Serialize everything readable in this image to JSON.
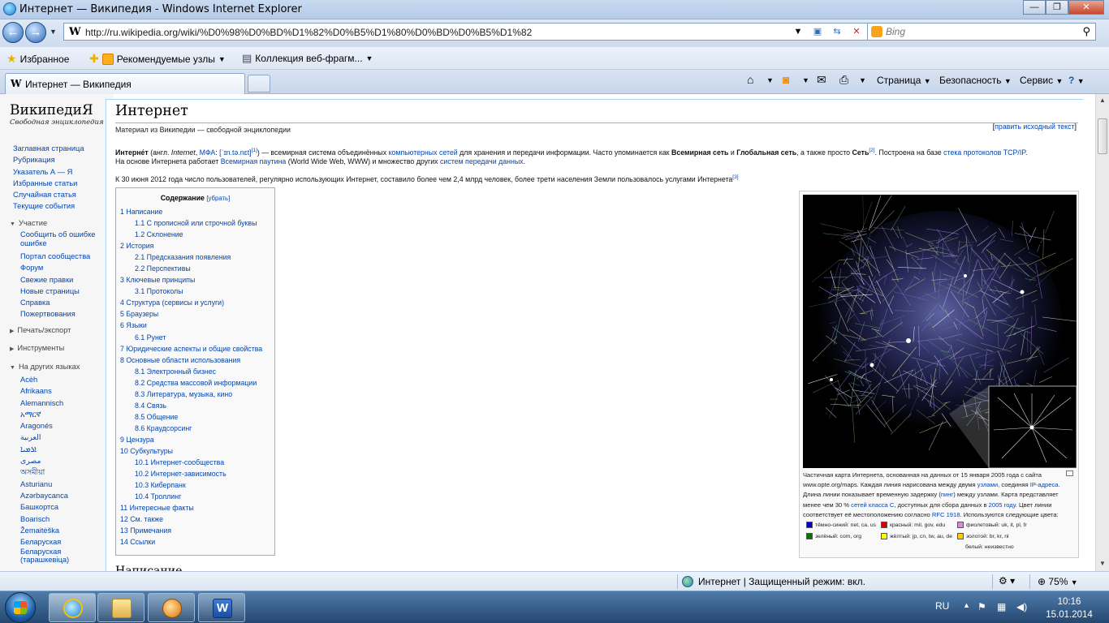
{
  "window": {
    "title": "Интернет — Википедия - Windows Internet Explorer",
    "minimize": "—",
    "maximize": "❐",
    "close": "✕"
  },
  "nav": {
    "back": "←",
    "forward": "→",
    "url": "http://ru.wikipedia.org/wiki/%D0%98%D0%BD%D1%82%D0%B5%D1%80%D0%BD%D0%B5%D1%82",
    "favicon": "W",
    "search_placeholder": "Bing"
  },
  "favbar": {
    "favorites": "Избранное",
    "suggested": "Рекомендуемые узлы",
    "gallery": "Коллекция веб-фрагм..."
  },
  "tab": {
    "label": "Интернет — Википедия",
    "favicon": "W"
  },
  "commands": {
    "page": "Страница",
    "safety": "Безопасность",
    "service": "Сервис",
    "help": "?"
  },
  "wiki": {
    "logo_title": "ВикипедиЯ",
    "logo_sub": "Свободная энциклопедия",
    "nav_links": [
      "Заглавная страница",
      "Рубрикация",
      "Указатель А — Я",
      "Избранные статьи",
      "Случайная статья",
      "Текущие события"
    ],
    "participation_head": "Участие",
    "participation_links": [
      "Сообщить об ошибке",
      "ошибке",
      "Портал сообщества",
      "Форум",
      "Свежие правки",
      "Новые страницы",
      "Справка",
      "Пожертвования"
    ],
    "print_head": "Печать/экспорт",
    "tools_head": "Инструменты",
    "lang_head": "На других языках",
    "languages": [
      "Acèh",
      "Afrikaans",
      "Alemannisch",
      "አማርኛ",
      "Aragonés",
      "العربية",
      "ܐܪܡܝܐ",
      "مصرى",
      "অসমীয়া",
      "Asturianu",
      "Azərbaycanca",
      "Башкортса",
      "Boarisch",
      "Žemaitėška",
      "Беларуская",
      "Беларуская",
      "(тарашкевіца)"
    ]
  },
  "article": {
    "title": "Интернет",
    "tagline": "Материал из Википедии — свободной энциклопедии",
    "edit_source": "править исходный текст",
    "p1_bold1": "Интерне́т",
    "p1_a": "(англ.",
    "p1_internet": "Internet",
    "p1_ipa_label": "МФА",
    "p1_ipa": "[ˈɪn.tə.nɛt]",
    "p1_sup1": "[1]",
    "p1_b": "— всемирная система объединённых",
    "p1_link1": "компьютерных сетей",
    "p1_c": "для хранения и передачи информации. Часто упоминается как",
    "p1_bold2": "Всемирная сеть",
    "p1_d": "и",
    "p1_bold3": "Глобальная сеть",
    "p1_e": ", а также просто",
    "p1_bold4": "Сеть",
    "p1_sup2": "[2]",
    "p1_f": ". Построена на базе",
    "p1_link2": "стека протоколов TCP/IP",
    "p1_g": "На основе Интернета работает",
    "p1_link3": "Всемирная паутина",
    "p1_h": "(World Wide Web, WWW) и множество других",
    "p1_link4": "систем передачи данных",
    "p2": "К 30 июня 2012 года число пользователей, регулярно использующих Интернет, составило более чем 2,4 млрд человек, более трети населения Земли пользовалось услугами Интернета",
    "p2_sup": "[3]",
    "next_heading": "Написание"
  },
  "toc": {
    "title": "Содержание",
    "hide": "[убрать]",
    "items": [
      {
        "text": "1 Написание",
        "sub": false
      },
      {
        "text": "1.1 С прописной или строчной буквы",
        "sub": true
      },
      {
        "text": "1.2 Склонение",
        "sub": true
      },
      {
        "text": "2 История",
        "sub": false
      },
      {
        "text": "2.1 Предсказания появления",
        "sub": true
      },
      {
        "text": "2.2 Перспективы",
        "sub": true
      },
      {
        "text": "3 Ключевые принципы",
        "sub": false
      },
      {
        "text": "3.1 Протоколы",
        "sub": true
      },
      {
        "text": "4 Структура (сервисы и услуги)",
        "sub": false
      },
      {
        "text": "5 Браузеры",
        "sub": false
      },
      {
        "text": "6 Языки",
        "sub": false
      },
      {
        "text": "6.1 Рунет",
        "sub": true
      },
      {
        "text": "7 Юридические аспекты и общие свойства",
        "sub": false
      },
      {
        "text": "8 Основные области использования",
        "sub": false
      },
      {
        "text": "8.1 Электронный бизнес",
        "sub": true
      },
      {
        "text": "8.2 Средства массовой информации",
        "sub": true
      },
      {
        "text": "8.3 Литература, музыка, кино",
        "sub": true
      },
      {
        "text": "8.4 Связь",
        "sub": true
      },
      {
        "text": "8.5 Общение",
        "sub": true
      },
      {
        "text": "8.6 Краудсорсинг",
        "sub": true
      },
      {
        "text": "9 Цензура",
        "sub": false
      },
      {
        "text": "10 Субкультуры",
        "sub": false
      },
      {
        "text": "10.1 Интернет-сообщества",
        "sub": true
      },
      {
        "text": "10.2 Интернет-зависимость",
        "sub": true
      },
      {
        "text": "10.3 Киберпанк",
        "sub": true
      },
      {
        "text": "10.4 Троллинг",
        "sub": true
      },
      {
        "text": "11 Интересные факты",
        "sub": false
      },
      {
        "text": "12 См. также",
        "sub": false
      },
      {
        "text": "13 Примечания",
        "sub": false
      },
      {
        "text": "14 Ссылки",
        "sub": false
      }
    ]
  },
  "figure": {
    "cap_l1": "Частичная карта Интернета, основанная на данных от 15 января 2005 года с сайта",
    "cap_l2a": "www.opte.org/maps. Каждая линия нарисована между двумя",
    "cap_l2_link1": "узлами",
    "cap_l2b": ", соединяя",
    "cap_l2_link2": "IP-адреса",
    "cap_l3a": "Длина линии показывает временную задержку (",
    "cap_l3_link": "пинг",
    "cap_l3b": ") между узлами. Карта представляет",
    "cap_l4a": "менее чем 30 %",
    "cap_l4_link1": "сетей класса C",
    "cap_l4b": ", доступных для сбора данных в",
    "cap_l4_link2": "2005 году",
    "cap_l4c": ". Цвет линии",
    "cap_l5a": "соответствует её местоположению согласно",
    "cap_l5_link": "RFC 1918",
    "cap_l5b": ". Используются следующие цвета:",
    "legend": [
      {
        "label": "тёмно-синий: net, ca, us",
        "color": "#0000cc"
      },
      {
        "label": "красный: mil, gov, edu",
        "color": "#dd0000"
      },
      {
        "label": "фиолетовый: uk, it, pl, fr",
        "color": "#dd88dd"
      },
      {
        "label": "зелёный: com, org",
        "color": "#007700"
      },
      {
        "label": "жёлтый: jp, cn, tw, au, de",
        "color": "#ffff00"
      },
      {
        "label": "золотой: br, kr, nl",
        "color": "#ffcc00"
      },
      {
        "label": "белый: неизвестно",
        "color": "#ffffff"
      }
    ]
  },
  "status": {
    "zone": "Интернет | Защищенный режим: вкл.",
    "zoom": "75%"
  },
  "taskbar": {
    "lang": "RU",
    "time": "10:16",
    "date": "15.01.2014"
  }
}
